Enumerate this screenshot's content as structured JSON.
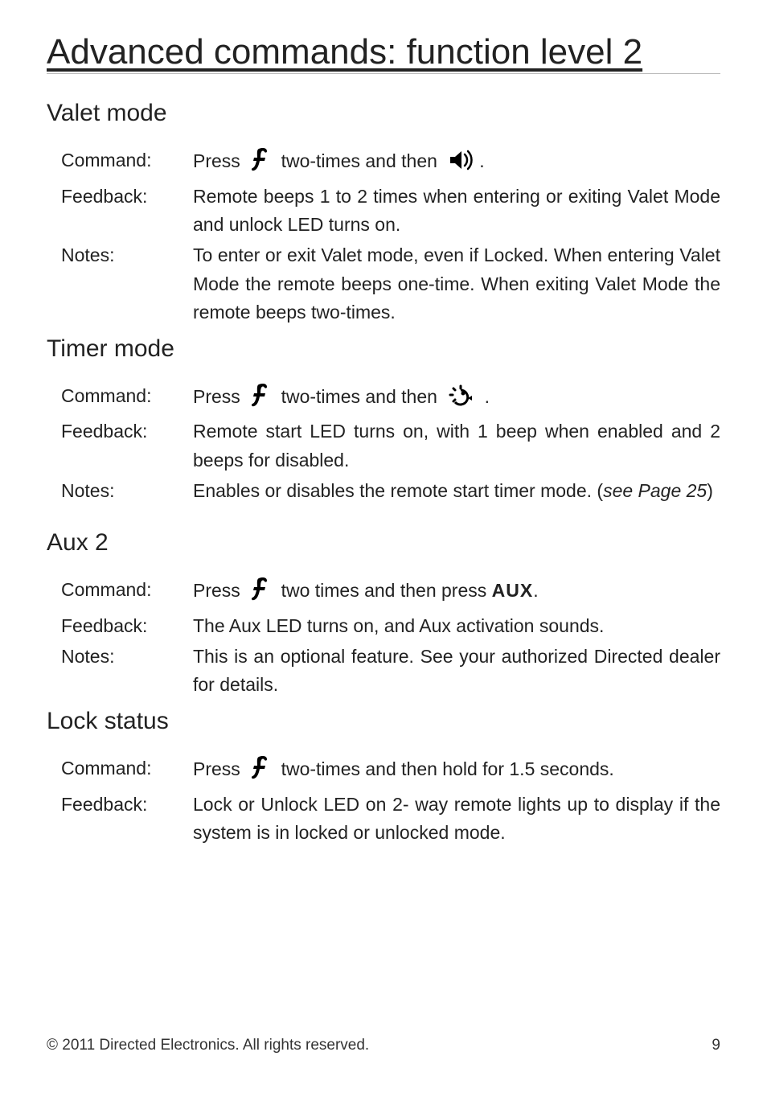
{
  "title": "Advanced commands: function level 2",
  "sections": [
    {
      "heading": "Valet mode",
      "rows": [
        {
          "label": "Command:",
          "parts": [
            {
              "t": "Press "
            },
            {
              "icon": "f"
            },
            {
              "t": " two-times and then "
            },
            {
              "icon": "sound"
            },
            {
              "t": "."
            }
          ]
        },
        {
          "label": "Feedback:",
          "text": "Remote beeps 1 to 2 times when entering or exiting Valet Mode and unlock LED turns on."
        },
        {
          "label": "Notes:",
          "text": "To enter or exit Valet mode, even if Locked. When entering Valet Mode the remote beeps one-time. When exiting Valet Mode the remote beeps two-times."
        }
      ]
    },
    {
      "heading": "Timer mode",
      "rows": [
        {
          "label": "Command:",
          "parts": [
            {
              "t": "Press "
            },
            {
              "icon": "f"
            },
            {
              "t": " two-times and then "
            },
            {
              "icon": "dial"
            },
            {
              "t": " ."
            }
          ]
        },
        {
          "label": "Feedback:",
          "text": "Remote start LED turns on, with 1 beep when enabled and 2 beeps for disabled."
        },
        {
          "label": "Notes:",
          "parts": [
            {
              "t": "Enables or disables the remote start timer mode. ("
            },
            {
              "ital": "see Page 25"
            },
            {
              "t": ")"
            }
          ]
        }
      ]
    },
    {
      "heading": "Aux 2",
      "rows": [
        {
          "label": "Command:",
          "parts": [
            {
              "t": "Press "
            },
            {
              "icon": "f"
            },
            {
              "t": " two times and then press "
            },
            {
              "bold": "AUX"
            },
            {
              "t": "."
            }
          ]
        },
        {
          "label": "Feedback:",
          "text": "The Aux LED turns on, and Aux activation sounds."
        },
        {
          "label": "Notes:",
          "text": "This is an optional feature. See your authorized Directed dealer for details."
        }
      ]
    },
    {
      "heading": "Lock status",
      "rows": [
        {
          "label": "Command:",
          "parts": [
            {
              "t": "Press "
            },
            {
              "icon": "f"
            },
            {
              "t": " two-times and then hold for 1.5 seconds."
            }
          ]
        },
        {
          "label": "Feedback:",
          "text": "Lock or Unlock LED on 2- way remote lights up to display if the system is in locked or unlocked mode."
        }
      ]
    }
  ],
  "footer_left": "© 2011 Directed Electronics. All rights reserved.",
  "footer_right": "9"
}
